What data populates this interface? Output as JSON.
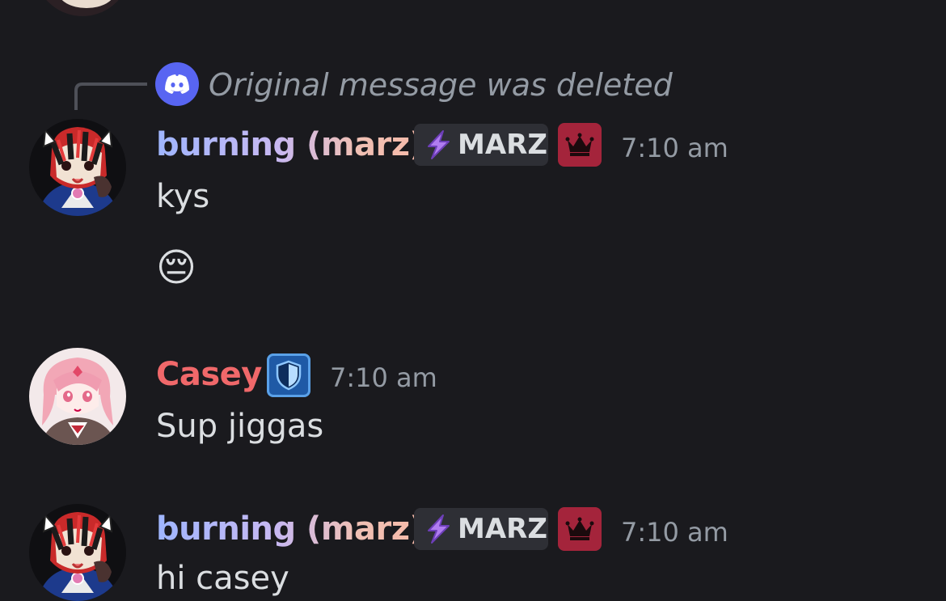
{
  "reply_preview": {
    "text": "Original message was deleted",
    "icon": "discord-icon"
  },
  "messages": [
    {
      "author": "burning (marz)",
      "author_style": "gradient",
      "tag": "MARZ",
      "tag_icon": "lightning-icon",
      "role_icon": "crown-icon",
      "time": "7:10 am",
      "lines": [
        "kys"
      ],
      "emoji": "😔"
    },
    {
      "author": "Casey",
      "author_color": "#f0686a",
      "role_icon": "shield-icon",
      "time": "7:10 am",
      "lines": [
        "Sup jiggas"
      ]
    },
    {
      "author": "burning (marz)",
      "author_style": "gradient",
      "tag": "MARZ",
      "tag_icon": "lightning-icon",
      "role_icon": "crown-icon",
      "time": "7:10 am",
      "lines": [
        "hi casey"
      ]
    }
  ],
  "colors": {
    "background": "#1a1a1e",
    "discord_blurple": "#5865f2",
    "crown_badge": "#a4243b",
    "shield_badge": "#1f5aa6"
  }
}
